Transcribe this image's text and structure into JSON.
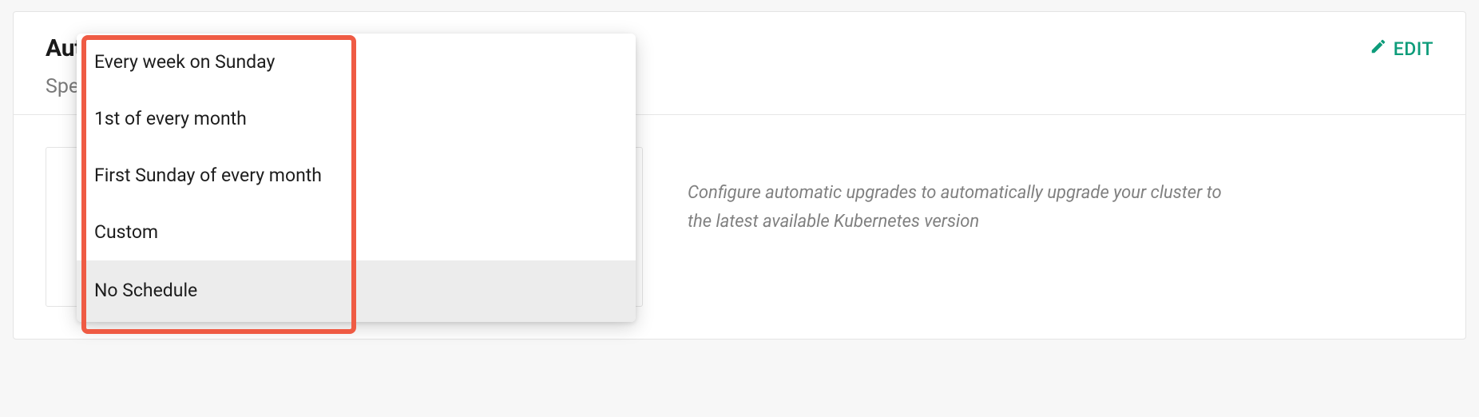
{
  "header": {
    "title_prefix": "Aut",
    "subtitle_prefix": "Spe",
    "edit_label": "EDIT"
  },
  "body": {
    "description": "Configure automatic upgrades to automatically upgrade your cluster to the latest available Kubernetes version"
  },
  "dropdown": {
    "options": [
      {
        "label": "Every week on Sunday"
      },
      {
        "label": "1st of every month"
      },
      {
        "label": "First Sunday of every month"
      },
      {
        "label": "Custom"
      },
      {
        "label": "No Schedule"
      }
    ],
    "selected_index": 4
  }
}
